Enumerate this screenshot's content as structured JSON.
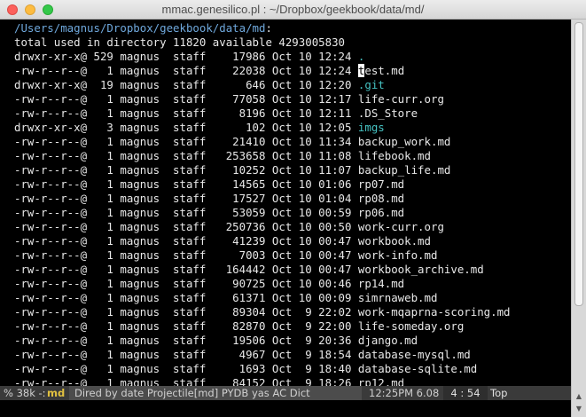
{
  "window": {
    "title": "mmac.genesilico.pl : ~/Dropbox/geekbook/data/md/"
  },
  "dired": {
    "directory": "/Users/magnus/Dropbox/geekbook/data/md",
    "summary": "total used in directory 11820 available 4293005830",
    "entries": [
      {
        "meta": "drwxr-xr-x@ 529 magnus  staff    17986 Oct 10 12:24 ",
        "name": ".",
        "is_dir": true
      },
      {
        "meta": "-rw-r--r--@   1 magnus  staff    22038 Oct 10 12:24 ",
        "name": "test.md",
        "cursor": true
      },
      {
        "meta": "drwxr-xr-x@  19 magnus  staff      646 Oct 10 12:20 ",
        "name": ".git",
        "is_dir": true
      },
      {
        "meta": "-rw-r--r--@   1 magnus  staff    77058 Oct 10 12:17 ",
        "name": "life-curr.org"
      },
      {
        "meta": "-rw-r--r--@   1 magnus  staff     8196 Oct 10 12:11 ",
        "name": ".DS_Store"
      },
      {
        "meta": "drwxr-xr-x@   3 magnus  staff      102 Oct 10 12:05 ",
        "name": "imgs",
        "is_dir": true
      },
      {
        "meta": "-rw-r--r--@   1 magnus  staff    21410 Oct 10 11:34 ",
        "name": "backup_work.md"
      },
      {
        "meta": "-rw-r--r--@   1 magnus  staff   253658 Oct 10 11:08 ",
        "name": "lifebook.md"
      },
      {
        "meta": "-rw-r--r--@   1 magnus  staff    10252 Oct 10 11:07 ",
        "name": "backup_life.md"
      },
      {
        "meta": "-rw-r--r--@   1 magnus  staff    14565 Oct 10 01:06 ",
        "name": "rp07.md"
      },
      {
        "meta": "-rw-r--r--@   1 magnus  staff    17527 Oct 10 01:04 ",
        "name": "rp08.md"
      },
      {
        "meta": "-rw-r--r--@   1 magnus  staff    53059 Oct 10 00:59 ",
        "name": "rp06.md"
      },
      {
        "meta": "-rw-r--r--@   1 magnus  staff   250736 Oct 10 00:50 ",
        "name": "work-curr.org"
      },
      {
        "meta": "-rw-r--r--@   1 magnus  staff    41239 Oct 10 00:47 ",
        "name": "workbook.md"
      },
      {
        "meta": "-rw-r--r--@   1 magnus  staff     7003 Oct 10 00:47 ",
        "name": "work-info.md"
      },
      {
        "meta": "-rw-r--r--@   1 magnus  staff   164442 Oct 10 00:47 ",
        "name": "workbook_archive.md"
      },
      {
        "meta": "-rw-r--r--@   1 magnus  staff    90725 Oct 10 00:46 ",
        "name": "rp14.md"
      },
      {
        "meta": "-rw-r--r--@   1 magnus  staff    61371 Oct 10 00:09 ",
        "name": "simrnaweb.md"
      },
      {
        "meta": "-rw-r--r--@   1 magnus  staff    89304 Oct  9 22:02 ",
        "name": "work-mqaprna-scoring.md"
      },
      {
        "meta": "-rw-r--r--@   1 magnus  staff    82870 Oct  9 22:00 ",
        "name": "life-someday.org"
      },
      {
        "meta": "-rw-r--r--@   1 magnus  staff    19506 Oct  9 20:36 ",
        "name": "django.md"
      },
      {
        "meta": "-rw-r--r--@   1 magnus  staff     4967 Oct  9 18:54 ",
        "name": "database-mysql.md"
      },
      {
        "meta": "-rw-r--r--@   1 magnus  staff     1693 Oct  9 18:40 ",
        "name": "database-sqlite.md"
      },
      {
        "meta": "-rw-r--r--@   1 magnus  staff    84152 Oct  9 18:26 ",
        "name": "rp12.md"
      }
    ]
  },
  "modeline": {
    "status": "% 38k -:",
    "buffer": "md",
    "modes": "Dired by date Projectile[md] PYDB yas AC Dict",
    "time": "12:25PM 6.08",
    "position": "4 : 54",
    "scroll": "Top"
  },
  "colors": {
    "directory_header": "#6fa8dc",
    "directory_name": "#45c1c1",
    "buffer_name": "#e0c040",
    "background": "#000000"
  },
  "icons": {
    "close": "close-icon",
    "minimize": "minimize-icon",
    "maximize": "maximize-icon",
    "scroll_up": "up-arrow-icon",
    "scroll_down": "down-arrow-icon"
  }
}
